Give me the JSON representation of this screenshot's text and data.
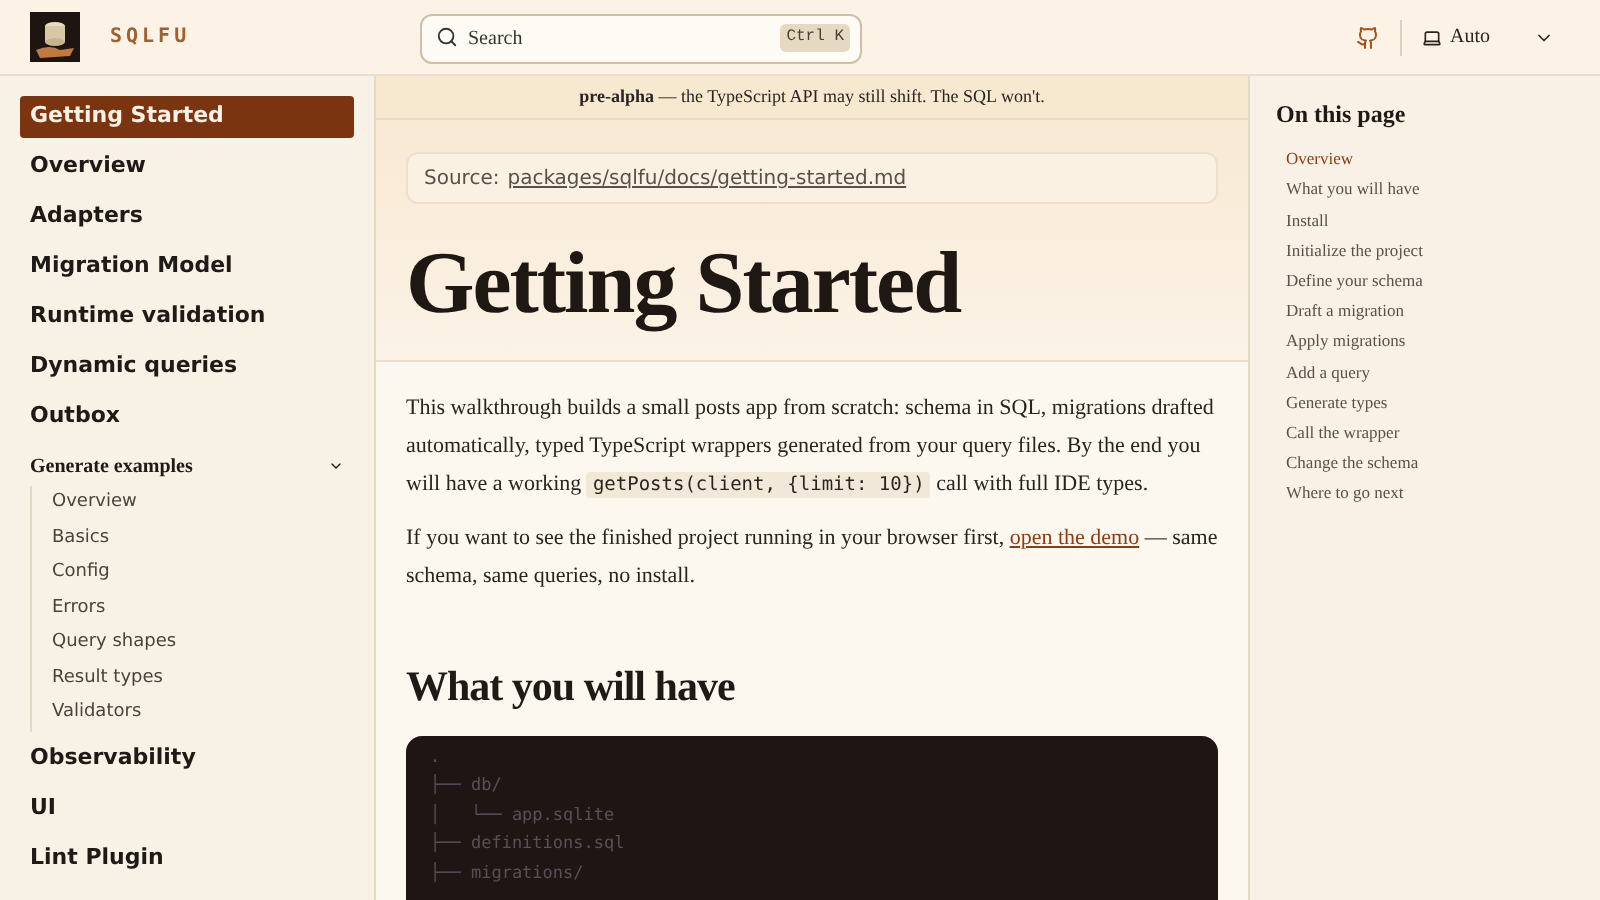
{
  "header": {
    "brand": "SQLFU",
    "search": {
      "placeholder": "Search",
      "shortcut": "Ctrl K"
    },
    "theme": {
      "label": "Auto"
    }
  },
  "sidebar": {
    "items": [
      {
        "kind": "link",
        "label": "Getting Started",
        "selected": true
      },
      {
        "kind": "link",
        "label": "Overview",
        "selected": false
      },
      {
        "kind": "link",
        "label": "Adapters",
        "selected": false
      },
      {
        "kind": "link",
        "label": "Migration Model",
        "selected": false
      },
      {
        "kind": "link",
        "label": "Runtime validation",
        "selected": false
      },
      {
        "kind": "link",
        "label": "Dynamic queries",
        "selected": false
      },
      {
        "kind": "link",
        "label": "Outbox",
        "selected": false
      },
      {
        "kind": "group",
        "label": "Generate examples",
        "selected": false,
        "expanded": true,
        "children": [
          {
            "label": "Overview",
            "selected": false
          },
          {
            "label": "Basics",
            "selected": false
          },
          {
            "label": "Config",
            "selected": false
          },
          {
            "label": "Errors",
            "selected": false
          },
          {
            "label": "Query shapes",
            "selected": false
          },
          {
            "label": "Result types",
            "selected": false
          },
          {
            "label": "Validators",
            "selected": false
          }
        ]
      },
      {
        "kind": "link",
        "label": "Observability",
        "selected": false
      },
      {
        "kind": "link",
        "label": "UI",
        "selected": false
      },
      {
        "kind": "link",
        "label": "Lint Plugin",
        "selected": false
      }
    ]
  },
  "banner": "**pre-alpha** — the TypeScript API may still shift. The SQL won't.",
  "source": {
    "label": "Source:",
    "link": "packages/sqlfu/docs/getting-started.md"
  },
  "title": "Getting Started",
  "paragraphs": [
    [
      {
        "kind": "text",
        "text": "This walkthrough builds a small posts app from scratch: schema in SQL, migrations drafted automatically, typed TypeScript wrappers generated from your query files. By the end you will have a working "
      },
      {
        "kind": "code",
        "text": "getPosts(client, {limit: 10})"
      },
      {
        "kind": "text",
        "text": " call with full IDE types."
      }
    ],
    [
      {
        "kind": "text",
        "text": "If you want to see the finished project running in your browser first, "
      },
      {
        "kind": "link",
        "text": "open the demo"
      },
      {
        "kind": "text",
        "text": " — same schema, same queries, no install."
      }
    ]
  ],
  "section_heading": "What you will have",
  "code_lines": [
    ".",
    "├── db/",
    "│   └── app.sqlite",
    "├── definitions.sql",
    "├── migrations/"
  ],
  "toc": {
    "title": "On this page",
    "items": [
      {
        "label": "Overview",
        "selected": true
      },
      {
        "label": "What you will have",
        "selected": false
      },
      {
        "label": "Install",
        "selected": false
      },
      {
        "label": "Initialize the project",
        "selected": false
      },
      {
        "label": "Define your schema",
        "selected": false
      },
      {
        "label": "Draft a migration",
        "selected": false
      },
      {
        "label": "Apply migrations",
        "selected": false
      },
      {
        "label": "Add a query",
        "selected": false
      },
      {
        "label": "Generate types",
        "selected": false
      },
      {
        "label": "Call the wrapper",
        "selected": false
      },
      {
        "label": "Change the schema",
        "selected": false
      },
      {
        "label": "Where to go next",
        "selected": false
      }
    ]
  }
}
